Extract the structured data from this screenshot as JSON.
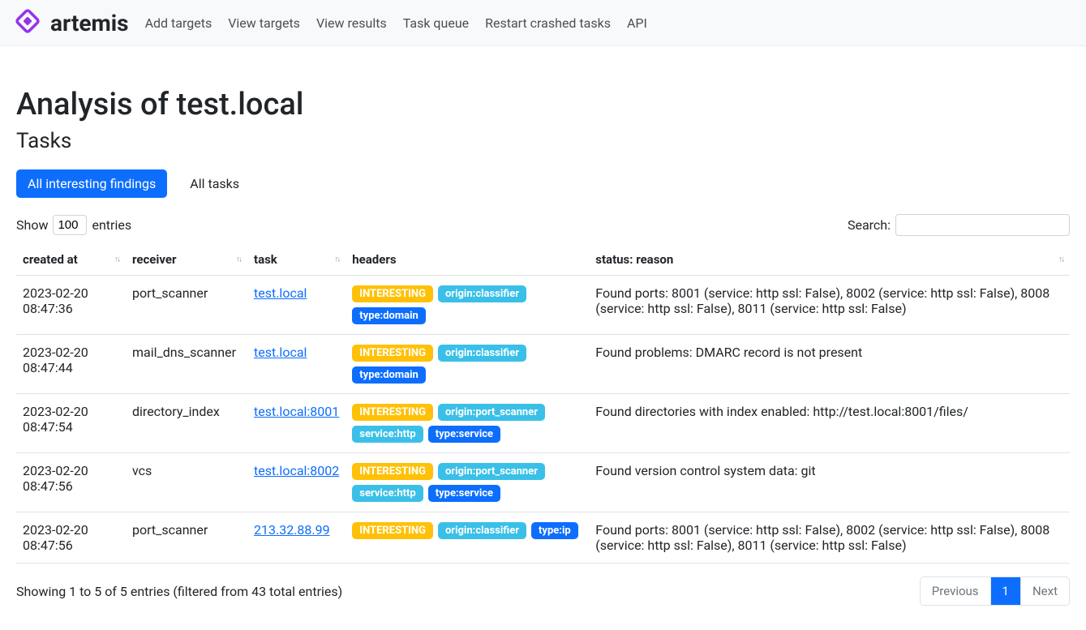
{
  "brand": "artemis",
  "nav": [
    "Add targets",
    "View targets",
    "View results",
    "Task queue",
    "Restart crashed tasks",
    "API"
  ],
  "page_title": "Analysis of test.local",
  "subtitle": "Tasks",
  "tabs": [
    {
      "label": "All interesting findings",
      "active": true
    },
    {
      "label": "All tasks",
      "active": false
    }
  ],
  "show_label": "Show",
  "entries_value": "100",
  "entries_label": "entries",
  "search_label": "Search:",
  "columns": [
    {
      "label": "created at",
      "sortable": true
    },
    {
      "label": "receiver",
      "sortable": true
    },
    {
      "label": "task",
      "sortable": true
    },
    {
      "label": "headers",
      "sortable": false
    },
    {
      "label": "status: reason",
      "sortable": true
    }
  ],
  "badge_colors": {
    "INTERESTING": "#ffc107",
    "origin:classifier": "#3ac0e8",
    "origin:port_scanner": "#3ac0e8",
    "type:domain": "#0d6efd",
    "service:http": "#3ac0e8",
    "type:service": "#0d6efd",
    "type:ip": "#0d6efd"
  },
  "rows": [
    {
      "created_at": "2023-02-20 08:47:36",
      "receiver": "port_scanner",
      "task": "test.local",
      "badges": [
        "INTERESTING",
        "origin:classifier",
        "type:domain"
      ],
      "status": "Found ports: 8001 (service: http ssl: False), 8002 (service: http ssl: False), 8008 (service: http ssl: False), 8011 (service: http ssl: False)"
    },
    {
      "created_at": "2023-02-20 08:47:44",
      "receiver": "mail_dns_scanner",
      "task": "test.local",
      "badges": [
        "INTERESTING",
        "origin:classifier",
        "type:domain"
      ],
      "status": "Found problems: DMARC record is not present"
    },
    {
      "created_at": "2023-02-20 08:47:54",
      "receiver": "directory_index",
      "task": "test.local:8001",
      "badges": [
        "INTERESTING",
        "origin:port_scanner",
        "service:http",
        "type:service"
      ],
      "status": "Found directories with index enabled: http://test.local:8001/files/"
    },
    {
      "created_at": "2023-02-20 08:47:56",
      "receiver": "vcs",
      "task": "test.local:8002",
      "badges": [
        "INTERESTING",
        "origin:port_scanner",
        "service:http",
        "type:service"
      ],
      "status": "Found version control system data: git"
    },
    {
      "created_at": "2023-02-20 08:47:56",
      "receiver": "port_scanner",
      "task": "213.32.88.99",
      "badges": [
        "INTERESTING",
        "origin:classifier",
        "type:ip"
      ],
      "status": "Found ports: 8001 (service: http ssl: False), 8002 (service: http ssl: False), 8008 (service: http ssl: False), 8011 (service: http ssl: False)"
    }
  ],
  "info_text": "Showing 1 to 5 of 5 entries (filtered from 43 total entries)",
  "pagination": {
    "prev": "Previous",
    "page": "1",
    "next": "Next"
  }
}
